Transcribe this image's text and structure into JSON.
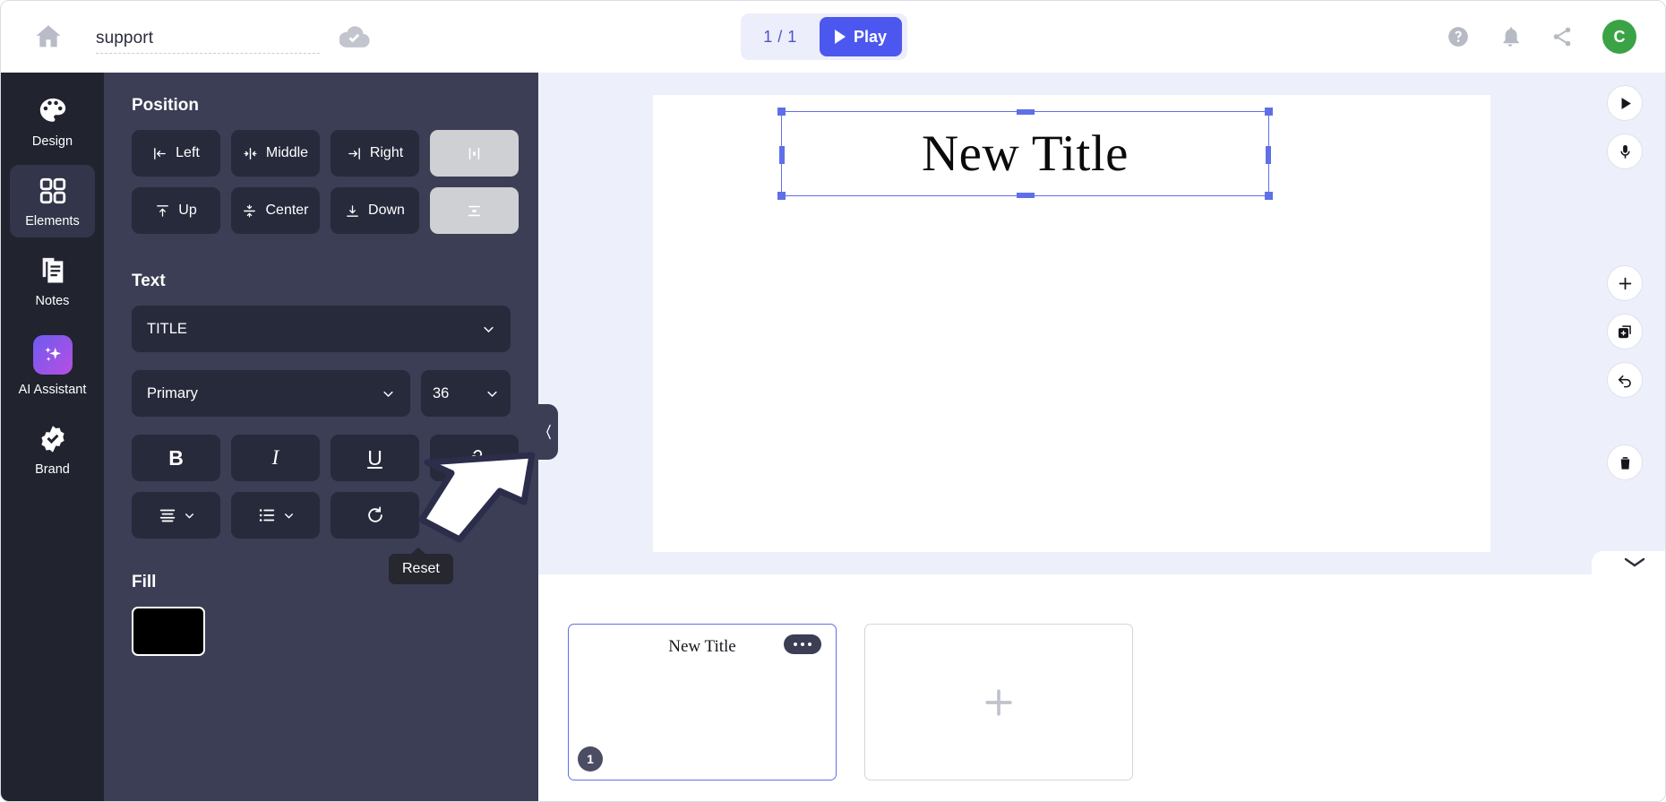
{
  "topbar": {
    "home_icon": "home-icon",
    "doc_title": "support",
    "doc_title_placeholder": "Untitled",
    "save_status_icon": "cloud-check-icon",
    "page_counter": "1 / 1",
    "play_label": "Play",
    "help_icon": "help-circle-icon",
    "notifications_icon": "bell-icon",
    "share_icon": "share-icon",
    "avatar_initial": "C"
  },
  "rail": {
    "items": [
      {
        "label": "Design",
        "icon": "palette-icon",
        "active": false
      },
      {
        "label": "Elements",
        "icon": "grid-icon",
        "active": true
      },
      {
        "label": "Notes",
        "icon": "notes-icon",
        "active": false
      },
      {
        "label": "AI Assistant",
        "icon": "sparkles-icon",
        "active": false
      },
      {
        "label": "Brand",
        "icon": "badge-check-icon",
        "active": false
      }
    ]
  },
  "panel": {
    "position": {
      "heading": "Position",
      "buttons": [
        {
          "label": "Left",
          "icon": "align-left-icon",
          "style": "dark"
        },
        {
          "label": "Middle",
          "icon": "align-center-h-icon",
          "style": "dark"
        },
        {
          "label": "Right",
          "icon": "align-right-icon",
          "style": "dark"
        },
        {
          "label": "",
          "icon": "distribute-horizontal-icon",
          "style": "light"
        },
        {
          "label": "Up",
          "icon": "align-top-icon",
          "style": "dark"
        },
        {
          "label": "Center",
          "icon": "align-center-v-icon",
          "style": "dark"
        },
        {
          "label": "Down",
          "icon": "align-bottom-icon",
          "style": "dark"
        },
        {
          "label": "",
          "icon": "distribute-vertical-icon",
          "style": "light"
        }
      ]
    },
    "text": {
      "heading": "Text",
      "style_value": "TITLE",
      "font_value": "Primary",
      "size_value": "36",
      "format_buttons": [
        {
          "label": "B",
          "icon": "bold-icon"
        },
        {
          "label": "I",
          "icon": "italic-icon"
        },
        {
          "label": "U",
          "icon": "underline-icon"
        },
        {
          "label": "",
          "icon": "link-icon"
        },
        {
          "label": "",
          "icon": "align-text-icon"
        },
        {
          "label": "",
          "icon": "bullet-list-icon"
        },
        {
          "label": "",
          "icon": "reset-icon"
        }
      ],
      "reset_tooltip": "Reset"
    },
    "fill": {
      "heading": "Fill",
      "color": "#000000"
    },
    "collapse_icon": "chevron-left-icon"
  },
  "stage": {
    "selected_text": "New Title",
    "tools": [
      {
        "icon": "play-icon"
      },
      {
        "icon": "microphone-icon"
      },
      {
        "icon": "plus-icon"
      },
      {
        "icon": "duplicate-icon"
      },
      {
        "icon": "undo-icon"
      },
      {
        "icon": "trash-icon"
      }
    ]
  },
  "tray": {
    "collapse_icon": "chevron-down-icon",
    "slides": [
      {
        "title": "New Title",
        "number": "1",
        "menu_icon": "more-dots-icon"
      }
    ],
    "add_slide_icon": "plus-icon"
  },
  "annotation": {
    "icon": "arrow-cursor-icon"
  },
  "colors": {
    "accent": "#4c57ef",
    "panel_bg": "#3b3e54",
    "rail_bg": "#21232f",
    "stage_bg": "#edf0fa",
    "avatar_bg": "#3aa345"
  }
}
